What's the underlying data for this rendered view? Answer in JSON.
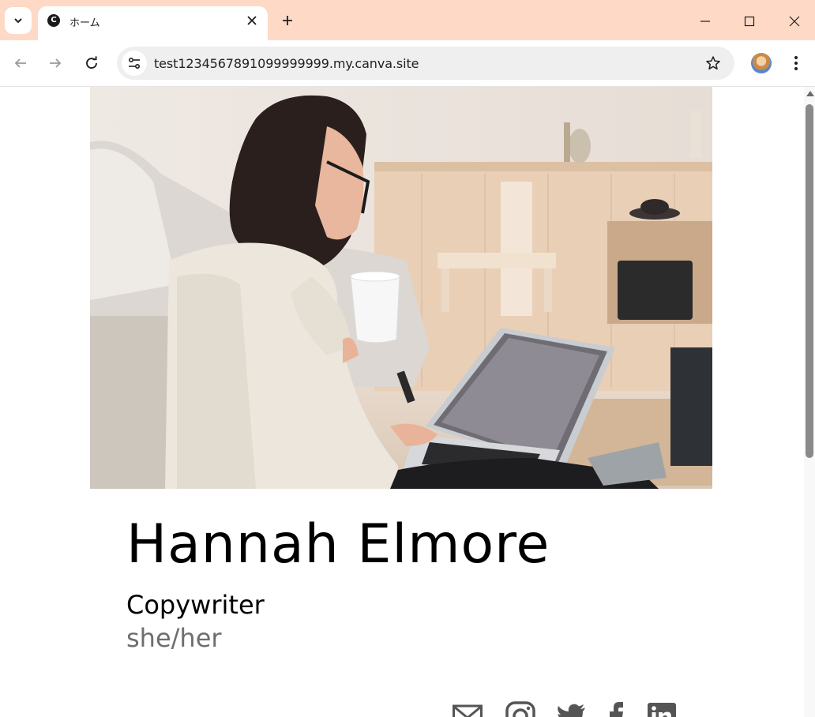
{
  "browser": {
    "tab": {
      "title": "ホーム",
      "favicon_letter": "C"
    },
    "url": "test1234567891099999999.my.canva.site",
    "icons": {
      "tab_search": "chevron-down-icon",
      "close_tab": "close-icon",
      "new_tab": "plus-icon",
      "minimize": "minimize-icon",
      "maximize": "maximize-icon",
      "close_window": "close-icon",
      "back": "arrow-left-icon",
      "forward": "arrow-right-icon",
      "reload": "reload-icon",
      "site_info": "tune-icon",
      "bookmark": "star-icon",
      "menu": "more-vert-icon"
    },
    "colors": {
      "tabbar": "#fdd9c6",
      "omnibox": "#efefef"
    }
  },
  "page": {
    "hero_image": "woman-with-laptop-and-mug-photo",
    "name": "Hannah Elmore",
    "role": "Copywriter",
    "pronouns": "she/her",
    "social_icons": [
      "mail-icon",
      "instagram-icon",
      "twitter-icon",
      "facebook-icon",
      "linkedin-icon"
    ],
    "colors": {
      "text": "#000000",
      "muted": "#6e6e6e",
      "icons": "#555555"
    }
  }
}
